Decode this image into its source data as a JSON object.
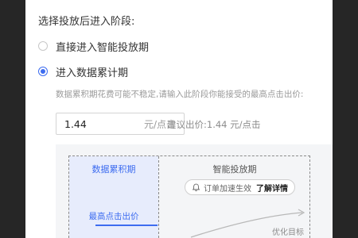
{
  "popover": {
    "heading": "选择投放后进入阶段:",
    "options": [
      {
        "label": "直接进入智能投放期",
        "checked": false
      },
      {
        "label": "进入数据累计期",
        "checked": true
      }
    ],
    "hint": "数据累积期花费可能不稳定,请输入此阶段你能接受的最高点击出价:",
    "bid_input": {
      "value": "1.44",
      "unit": "元/点击"
    },
    "suggested_bid": "建议出价:1.44 元/点击",
    "diagram": {
      "stage_accumulate": "数据累积期",
      "stage_smart": "智能投放期",
      "max_bid_label": "最高点击出价",
      "tip_text": "订单加速生效",
      "tip_link": "了解详情",
      "target_label": "优化目标"
    }
  },
  "colors": {
    "accent": "#3d6cf0",
    "backdrop": "#262626"
  },
  "icons": {
    "tip": "bell-icon"
  }
}
